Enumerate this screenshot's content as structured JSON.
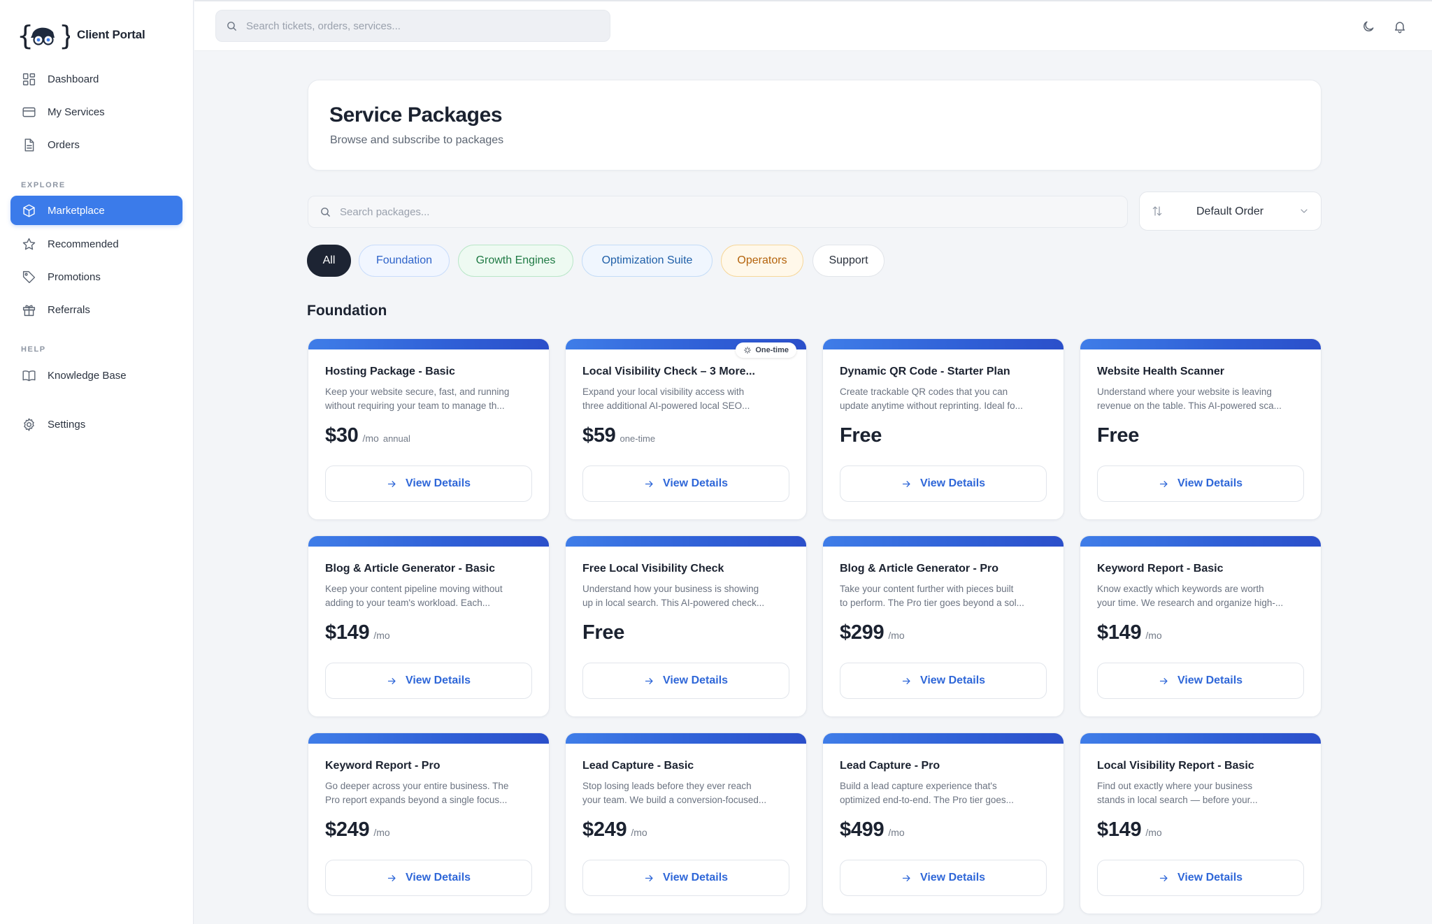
{
  "app": {
    "title": "Client Portal"
  },
  "sidebar": {
    "items_main": [
      {
        "label": "Dashboard",
        "icon": "dashboard-icon"
      },
      {
        "label": "My Services",
        "icon": "card-icon"
      },
      {
        "label": "Orders",
        "icon": "document-icon"
      }
    ],
    "explore_heading": "EXPLORE",
    "items_explore": [
      {
        "label": "Marketplace",
        "icon": "cube-icon",
        "active": true
      },
      {
        "label": "Recommended",
        "icon": "star-icon"
      },
      {
        "label": "Promotions",
        "icon": "tag-icon"
      },
      {
        "label": "Referrals",
        "icon": "gift-icon"
      }
    ],
    "help_heading": "HELP",
    "items_help": [
      {
        "label": "Knowledge Base",
        "icon": "book-icon"
      }
    ],
    "settings_label": "Settings",
    "active_color": "#3b7bea"
  },
  "topbar": {
    "search_placeholder": "Search tickets, orders, services...",
    "icons": [
      "moon-icon",
      "bell-icon"
    ]
  },
  "header": {
    "title": "Service Packages",
    "subtitle": "Browse and subscribe to packages"
  },
  "filters": {
    "search_placeholder": "Search packages...",
    "sort_label": "Default Order",
    "chips": [
      {
        "label": "All",
        "active": true
      },
      {
        "label": "Foundation"
      },
      {
        "label": "Growth Engines"
      },
      {
        "label": "Optimization Suite"
      },
      {
        "label": "Operators"
      },
      {
        "label": "Support"
      }
    ]
  },
  "section": {
    "heading": "Foundation"
  },
  "cards": [
    {
      "title": "Hosting Package - Basic",
      "desc1": "Keep your website secure, fast, and running",
      "desc2": "without requiring your team to manage th...",
      "price": "$30",
      "unit": "/mo",
      "note": "annual",
      "button": "View Details"
    },
    {
      "title": "Local Visibility Check – 3 More...",
      "desc1": "Expand your local visibility access with",
      "desc2": "three additional AI-powered local SEO...",
      "price": "$59",
      "unit": "",
      "note": "one-time",
      "button": "View Details",
      "badge": "One-time"
    },
    {
      "title": "Dynamic QR Code - Starter Plan",
      "desc1": "Create trackable QR codes that you can",
      "desc2": "update anytime without reprinting. Ideal fo...",
      "price": "Free",
      "unit": "",
      "note": "",
      "button": "View Details"
    },
    {
      "title": "Website Health Scanner",
      "desc1": "Understand where your website is leaving",
      "desc2": "revenue on the table. This AI-powered sca...",
      "price": "Free",
      "unit": "",
      "note": "",
      "button": "View Details"
    },
    {
      "title": "Blog & Article Generator - Basic",
      "desc1": "Keep your content pipeline moving without",
      "desc2": "adding to your team's workload. Each...",
      "price": "$149",
      "unit": "/mo",
      "note": "",
      "button": "View Details"
    },
    {
      "title": "Free Local Visibility Check",
      "desc1": "Understand how your business is showing",
      "desc2": "up in local search. This AI-powered check...",
      "price": "Free",
      "unit": "",
      "note": "",
      "button": "View Details"
    },
    {
      "title": "Blog & Article Generator - Pro",
      "desc1": "Take your content further with pieces built",
      "desc2": "to perform. The Pro tier goes beyond a sol...",
      "price": "$299",
      "unit": "/mo",
      "note": "",
      "button": "View Details"
    },
    {
      "title": "Keyword Report - Basic",
      "desc1": "Know exactly which keywords are worth",
      "desc2": "your time. We research and organize high-...",
      "price": "$149",
      "unit": "/mo",
      "note": "",
      "button": "View Details"
    },
    {
      "title": "Keyword Report - Pro",
      "desc1": "Go deeper across your entire business. The",
      "desc2": "Pro report expands beyond a single focus...",
      "price": "$249",
      "unit": "/mo",
      "note": "",
      "button": "View Details"
    },
    {
      "title": "Lead Capture - Basic",
      "desc1": "Stop losing leads before they ever reach",
      "desc2": "your team. We build a conversion-focused...",
      "price": "$249",
      "unit": "/mo",
      "note": "",
      "button": "View Details"
    },
    {
      "title": "Lead Capture - Pro",
      "desc1": "Build a lead capture experience that's",
      "desc2": "optimized end-to-end. The Pro tier goes...",
      "price": "$499",
      "unit": "/mo",
      "note": "",
      "button": "View Details"
    },
    {
      "title": "Local Visibility Report - Basic",
      "desc1": "Find out exactly where your business",
      "desc2": "stands in local search — before your...",
      "price": "$149",
      "unit": "/mo",
      "note": "",
      "button": "View Details"
    }
  ]
}
